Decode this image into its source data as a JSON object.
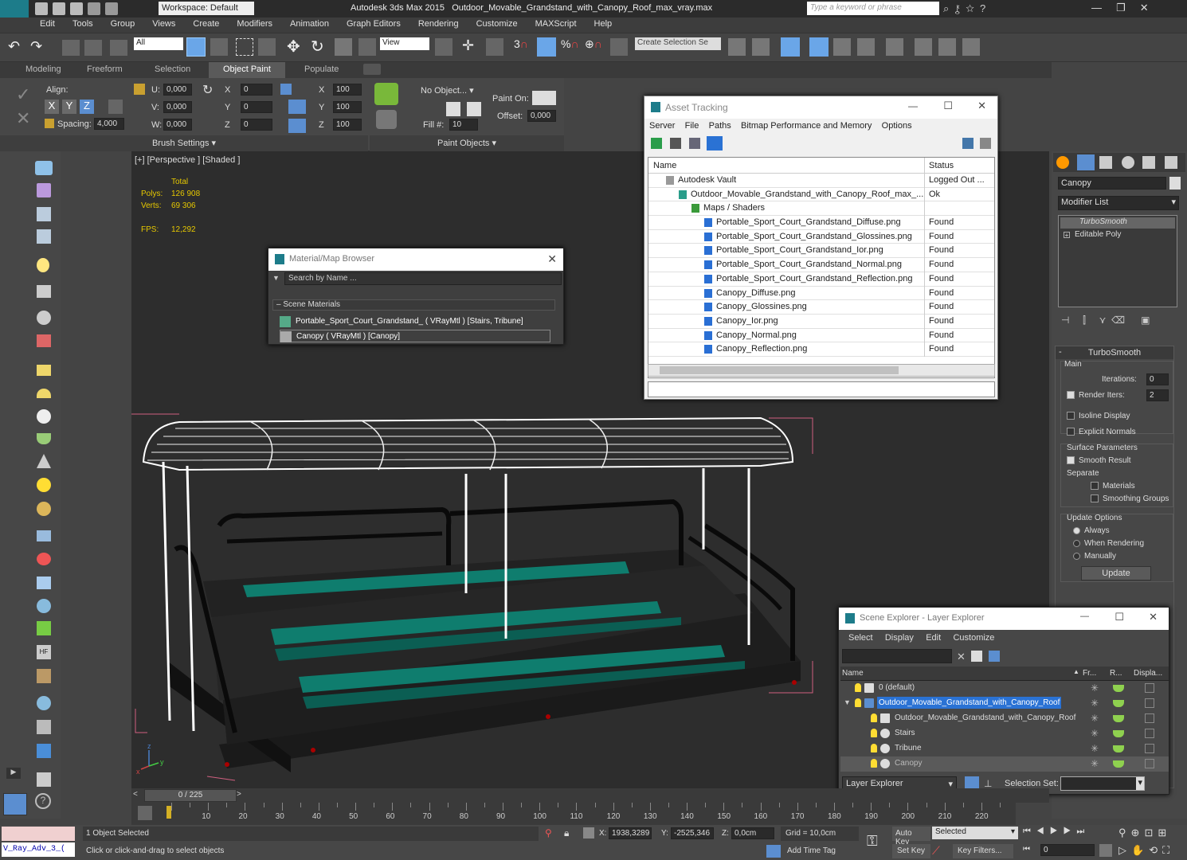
{
  "title": {
    "app": "Autodesk 3ds Max  2015",
    "file": "Outdoor_Movable_Grandstand_with_Canopy_Roof_max_vray.max",
    "workspace": "Workspace: Default",
    "search_placeholder": "Type a keyword or phrase",
    "logo": "MAX"
  },
  "menu": [
    "Edit",
    "Tools",
    "Group",
    "Views",
    "Create",
    "Modifiers",
    "Animation",
    "Graph Editors",
    "Rendering",
    "Customize",
    "MAXScript",
    "Help"
  ],
  "toolbar": {
    "filter": "All",
    "refcoord": "View",
    "selset": "Create Selection Se"
  },
  "ribbon": {
    "tabs": [
      "Modeling",
      "Freeform",
      "Selection",
      "Object Paint",
      "Populate"
    ],
    "align": "Align:",
    "u_label": "U:",
    "v_label": "V:",
    "w_label": "W:",
    "u": "0,000",
    "v": "0,000",
    "w": "0,000",
    "spacing_label": "Spacing:",
    "spacing": "4,000",
    "x": "0",
    "y": "0",
    "z": "0",
    "sx": "100",
    "sy": "100",
    "sz": "100",
    "no_object": "No Object...",
    "paint_on": "Paint On:",
    "offset_label": "Offset:",
    "offset": "0,000",
    "fill_label": "Fill #:",
    "fill": "10",
    "brush_settings": "Brush Settings",
    "paint_objects": "Paint Objects",
    "xyz": [
      "X",
      "Y",
      "Z"
    ]
  },
  "viewport": {
    "label": "[+] [Perspective ] [Shaded ]",
    "total": "Total",
    "polys_label": "Polys:",
    "polys": "126 908",
    "verts_label": "Verts:",
    "verts": "69 306",
    "fps_label": "FPS:",
    "fps": "12,292",
    "axes": [
      "x",
      "y",
      "z"
    ]
  },
  "asset": {
    "title": "Asset Tracking",
    "menu": [
      "Server",
      "File",
      "Paths",
      "Bitmap Performance and Memory",
      "Options"
    ],
    "col_name": "Name",
    "col_status": "Status",
    "rows": [
      {
        "name": "Autodesk Vault",
        "status": "Logged Out ..."
      },
      {
        "name": "Outdoor_Movable_Grandstand_with_Canopy_Roof_max_...",
        "status": "Ok"
      },
      {
        "name": "Maps / Shaders",
        "status": ""
      },
      {
        "name": "Portable_Sport_Court_Grandstand_Diffuse.png",
        "status": "Found"
      },
      {
        "name": "Portable_Sport_Court_Grandstand_Glossines.png",
        "status": "Found"
      },
      {
        "name": "Portable_Sport_Court_Grandstand_Ior.png",
        "status": "Found"
      },
      {
        "name": "Portable_Sport_Court_Grandstand_Normal.png",
        "status": "Found"
      },
      {
        "name": "Portable_Sport_Court_Grandstand_Reflection.png",
        "status": "Found"
      },
      {
        "name": "Canopy_Diffuse.png",
        "status": "Found"
      },
      {
        "name": "Canopy_Glossines.png",
        "status": "Found"
      },
      {
        "name": "Canopy_Ior.png",
        "status": "Found"
      },
      {
        "name": "Canopy_Normal.png",
        "status": "Found"
      },
      {
        "name": "Canopy_Reflection.png",
        "status": "Found"
      }
    ]
  },
  "matbrowser": {
    "title": "Material/Map Browser",
    "search": "Search by Name ...",
    "section": "Scene Materials",
    "items": [
      "Portable_Sport_Court_Grandstand_  ( VRayMtl ) [Stairs, Tribune]",
      "Canopy  ( VRayMtl ) [Canopy]"
    ]
  },
  "cmdpanel": {
    "name": "Canopy",
    "modlist": "Modifier List",
    "stack": [
      "TurboSmooth",
      "Editable Poly"
    ],
    "rollout": "TurboSmooth",
    "main": "Main",
    "iter_label": "Iterations:",
    "iter": "0",
    "render_iter_label": "Render Iters:",
    "render_iter": "2",
    "isoline": "Isoline Display",
    "explicit": "Explicit Normals",
    "surface": "Surface Parameters",
    "smooth_result": "Smooth Result",
    "separate": "Separate",
    "materials": "Materials",
    "smoothing": "Smoothing Groups",
    "update_options": "Update Options",
    "always": "Always",
    "when_rendering": "When Rendering",
    "manually": "Manually",
    "update": "Update"
  },
  "scene": {
    "title": "Scene Explorer - Layer Explorer",
    "menu": [
      "Select",
      "Display",
      "Edit",
      "Customize"
    ],
    "cols": [
      "Name",
      "Fr...",
      "R...",
      "Displa..."
    ],
    "rows": [
      "0 (default)",
      "Outdoor_Movable_Grandstand_with_Canopy_Roof",
      "Outdoor_Movable_Grandstand_with_Canopy_Roof",
      "Stairs",
      "Tribune",
      "Canopy"
    ],
    "footer": "Layer Explorer",
    "selset": "Selection Set:"
  },
  "timeline": {
    "frame": "0 / 225",
    "ticks": [
      "10",
      "20",
      "30",
      "40",
      "50",
      "60",
      "70",
      "80",
      "90",
      "100",
      "110",
      "120",
      "130",
      "140",
      "150",
      "160",
      "170",
      "180",
      "190",
      "200",
      "210",
      "220"
    ]
  },
  "status": {
    "script": "V_Ray_Adv_3_(",
    "selected": "1 Object Selected",
    "hint": "Click or click-and-drag to select objects",
    "x_label": "X:",
    "x": "1938,3289",
    "y_label": "Y:",
    "y": "-2525,346",
    "z_label": "Z:",
    "z": "0,0cm",
    "grid": "Grid = 10,0cm",
    "autokey": "Auto Key",
    "selected_dd": "Selected",
    "setkey": "Set Key",
    "keyfilters": "Key Filters...",
    "addtimetag": "Add Time Tag",
    "frame": "0"
  }
}
